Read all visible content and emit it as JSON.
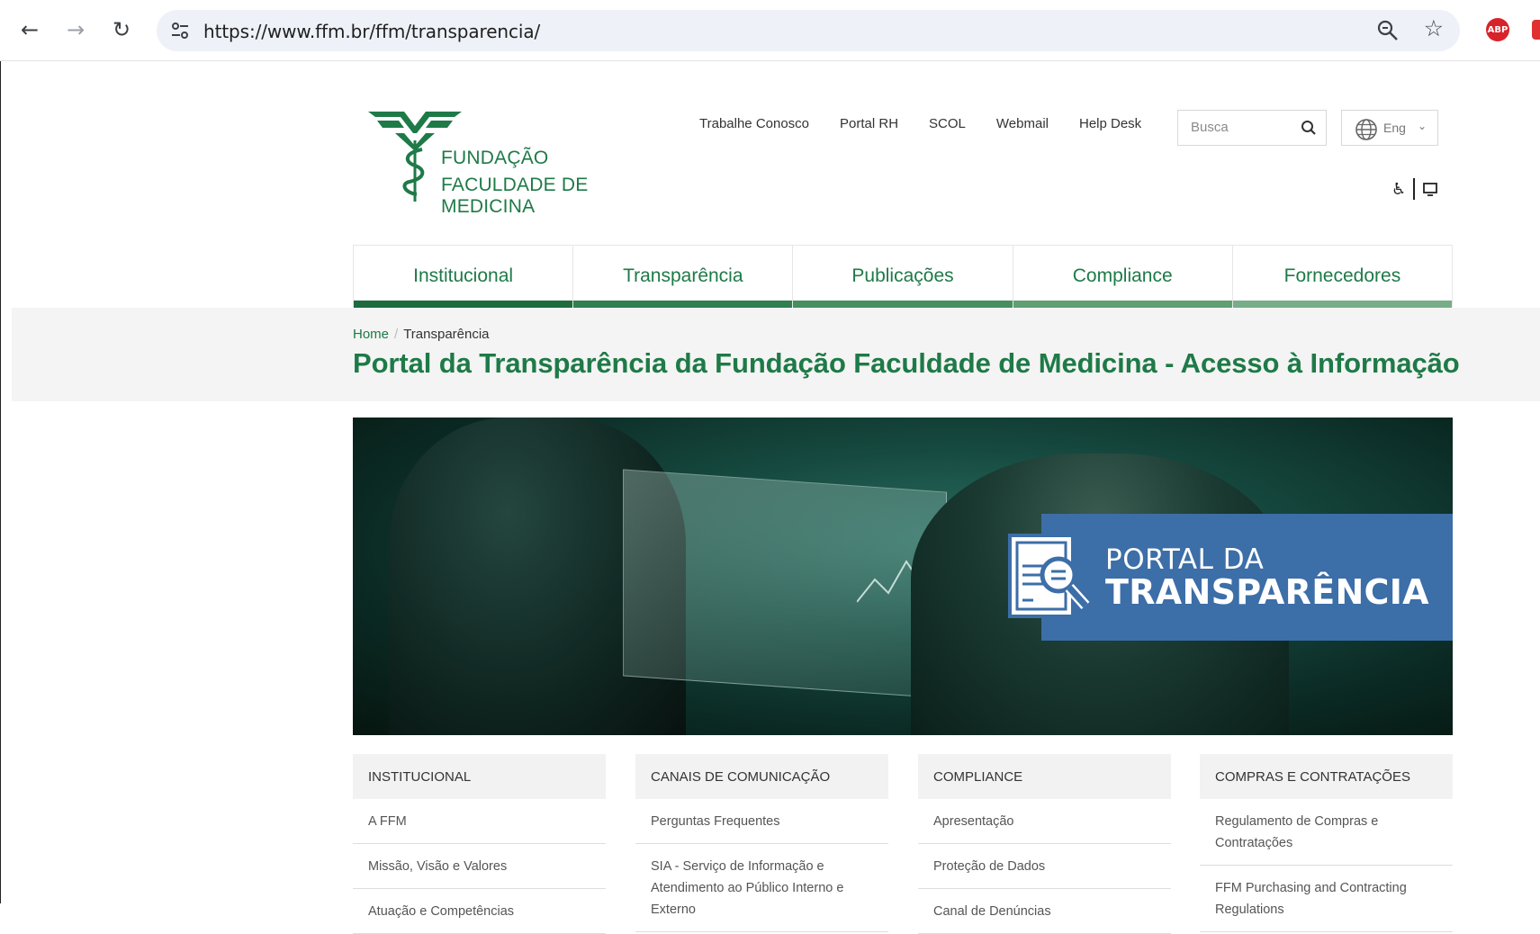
{
  "browser": {
    "url": "https://www.ffm.br/ffm/transparencia/",
    "extension_abp": "ABP"
  },
  "logo": {
    "line1": "FUNDAÇÃO",
    "line2": "FACULDADE DE MEDICINA"
  },
  "top_links": [
    "Trabalhe Conosco",
    "Portal RH",
    "SCOL",
    "Webmail",
    "Help Desk"
  ],
  "search": {
    "placeholder": "Busca"
  },
  "language": {
    "selected": "Eng"
  },
  "main_nav": [
    "Institucional",
    "Transparência",
    "Publicações",
    "Compliance",
    "Fornecedores"
  ],
  "breadcrumb": {
    "home": "Home",
    "current": "Transparência"
  },
  "page_title": "Portal da Transparência da Fundação Faculdade de Medicina - Acesso à Informação",
  "hero": {
    "line1": "PORTAL DA",
    "line2": "TRANSPARÊNCIA"
  },
  "columns": [
    {
      "title": "INSTITUCIONAL",
      "items": [
        "A FFM",
        "Missão, Visão e Valores",
        "Atuação e Competências"
      ]
    },
    {
      "title": "CANAIS DE COMUNICAÇÃO",
      "items": [
        "Perguntas Frequentes",
        "SIA - Serviço de Informação e Atendimento ao Público Interno e Externo"
      ]
    },
    {
      "title": "COMPLIANCE",
      "items": [
        "Apresentação",
        "Proteção de Dados",
        "Canal de Denúncias"
      ]
    },
    {
      "title": "COMPRAS E CONTRATAÇÕES",
      "items": [
        "Regulamento de Compras e Contratações",
        "FFM Purchasing and Contracting Regulations"
      ]
    }
  ],
  "colors": {
    "brand_green": "#1e7a47",
    "banner_blue": "#3c6ea8"
  }
}
